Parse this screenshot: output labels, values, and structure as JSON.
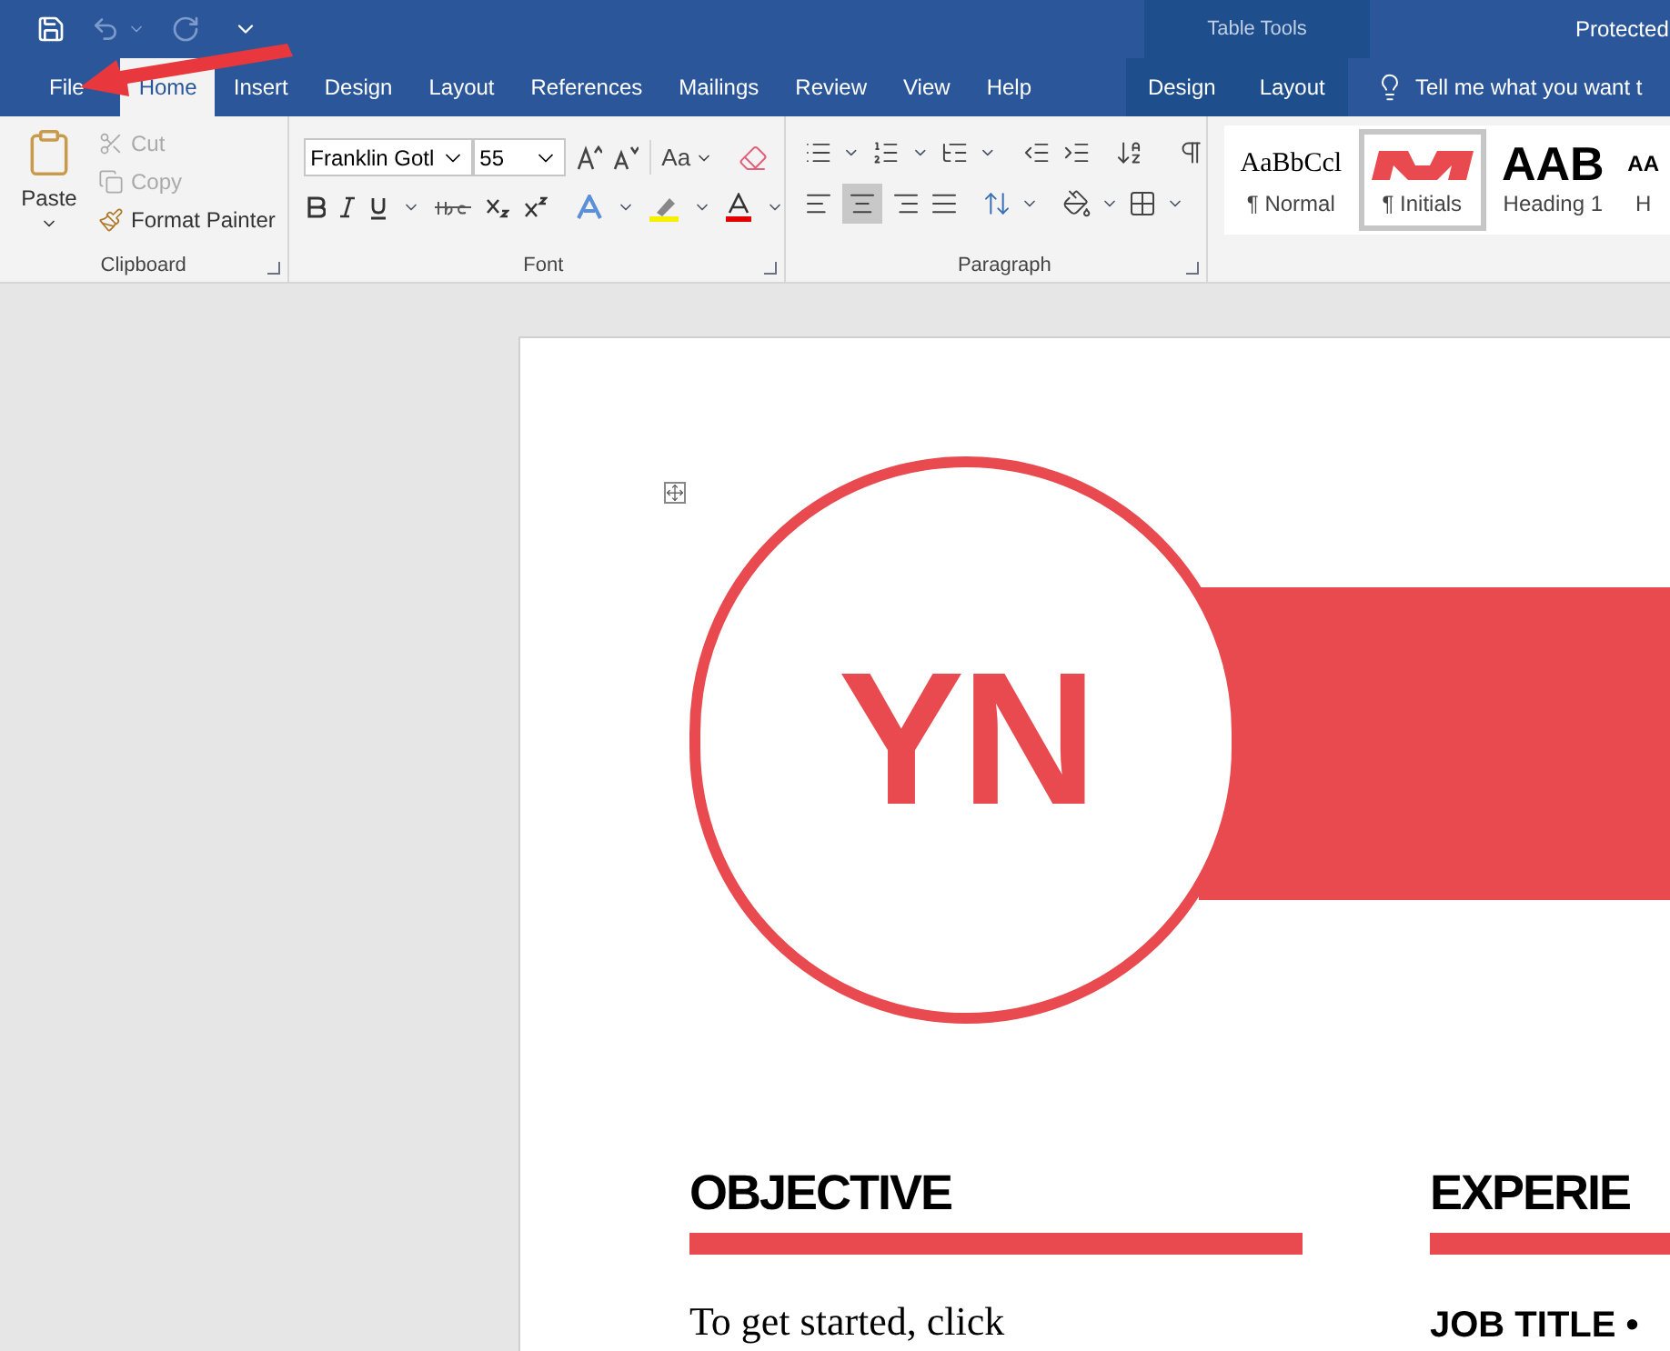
{
  "title_bar": {
    "contextual_label": "Table Tools",
    "document_title": "Protected"
  },
  "ribbon_tabs": [
    {
      "label": "File",
      "kind": "file",
      "selected": false
    },
    {
      "label": "Home",
      "kind": "tab",
      "selected": true
    },
    {
      "label": "Insert",
      "kind": "tab",
      "selected": false
    },
    {
      "label": "Design",
      "kind": "tab",
      "selected": false
    },
    {
      "label": "Layout",
      "kind": "tab",
      "selected": false
    },
    {
      "label": "References",
      "kind": "tab",
      "selected": false
    },
    {
      "label": "Mailings",
      "kind": "tab",
      "selected": false
    },
    {
      "label": "Review",
      "kind": "tab",
      "selected": false
    },
    {
      "label": "View",
      "kind": "tab",
      "selected": false
    },
    {
      "label": "Help",
      "kind": "tab",
      "selected": false
    },
    {
      "label": "Design",
      "kind": "contextual",
      "selected": false
    },
    {
      "label": "Layout",
      "kind": "contextual",
      "selected": false
    }
  ],
  "tell_me": {
    "placeholder": "Tell me what you want t"
  },
  "clipboard": {
    "paste": "Paste",
    "cut": {
      "label": "Cut",
      "disabled": true
    },
    "copy": {
      "label": "Copy",
      "disabled": true
    },
    "format_painter": "Format Painter",
    "group_label": "Clipboard"
  },
  "font": {
    "font_name": "Franklin Gotl",
    "font_size": "55",
    "change_case": "Aa",
    "group_label": "Font"
  },
  "paragraph": {
    "group_label": "Paragraph"
  },
  "styles": [
    {
      "preview": "AaBbCcl",
      "label": "¶ Normal",
      "kind": "serif",
      "selected": false
    },
    {
      "label": "¶ Initials",
      "kind": "graphic",
      "selected": true
    },
    {
      "preview": "AAB",
      "label": "Heading 1",
      "kind": "bold",
      "selected": false
    },
    {
      "preview": "AA",
      "label": "H",
      "kind": "bold-small",
      "selected": false
    }
  ],
  "document": {
    "monogram": "YN",
    "objective": {
      "heading": "OBJECTIVE",
      "text": "To get started, click"
    },
    "experience": {
      "heading": "EXPERIE",
      "job_title": "JOB TITLE •"
    }
  }
}
